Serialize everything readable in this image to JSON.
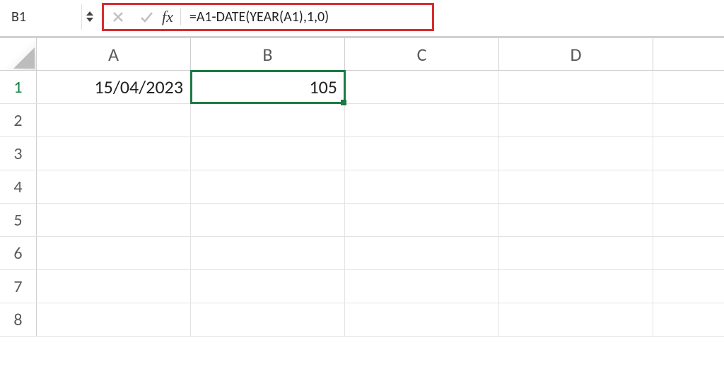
{
  "namebox": {
    "value": "B1"
  },
  "formula_bar": {
    "fx_label": "fx",
    "formula": "=A1-DATE(YEAR(A1),1,0)"
  },
  "columns": [
    "A",
    "B",
    "C",
    "D",
    ""
  ],
  "rows": [
    "1",
    "2",
    "3",
    "4",
    "5",
    "6",
    "7",
    "8"
  ],
  "cells": {
    "A1": "15/04/2023",
    "B1": "105"
  },
  "active_cell": "B1"
}
